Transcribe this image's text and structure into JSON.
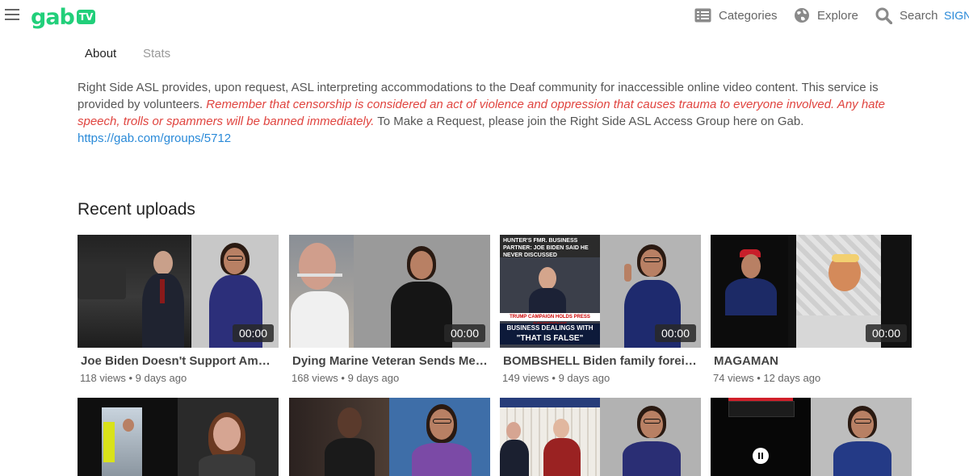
{
  "header": {
    "logo_text": "gab",
    "logo_badge": "TV",
    "nav": [
      {
        "label": "Categories",
        "icon": "categories-icon"
      },
      {
        "label": "Explore",
        "icon": "globe-icon"
      },
      {
        "label": "Search",
        "icon": "search-icon"
      }
    ],
    "signup_label": "SIGN"
  },
  "tabs": [
    {
      "label": "About",
      "active": true
    },
    {
      "label": "Stats",
      "active": false
    }
  ],
  "about": {
    "intro": "Right Side ASL provides, upon request, ASL interpreting accommodations to the Deaf community for inaccessible online video content. This service is provided by volunteers.",
    "warning": "Remember that censorship is considered an act of violence and oppression that causes trauma to everyone involved. Any hate speech, trolls or spammers will be banned immediately.",
    "request": "To Make a Request, please join the Right Side ASL Access Group here on Gab.",
    "link": "https://gab.com/groups/5712"
  },
  "recent_uploads": {
    "title": "Recent uploads",
    "videos": [
      {
        "title": "Joe Biden Doesn't Support Ameri...",
        "duration": "00:00",
        "views": "118 views",
        "age": "9 days ago"
      },
      {
        "title": "Dying Marine Veteran Sends Mess...",
        "duration": "00:00",
        "views": "168 views",
        "age": "9 days ago"
      },
      {
        "title": "BOMBSHELL Biden family foreign ...",
        "duration": "00:00",
        "views": "149 views",
        "age": "9 days ago",
        "thumb_text": {
          "top": "HUNTER'S FMR. BUSINESS PARTNER: JOE BIDEN SAID HE NEVER DISCUSSED",
          "mid": "TRUMP CAMPAIGN HOLDS PRESS CONFERENCE",
          "bottom": "BUSINESS DEALINGS WITH SON",
          "quote": "\"THAT IS FALSE\""
        }
      },
      {
        "title": "MAGAMAN",
        "duration": "00:00",
        "views": "74 views",
        "age": "12 days ago"
      }
    ]
  },
  "colors": {
    "brand": "#21cf7a",
    "link": "#2a8ad8",
    "warning": "#e0443f"
  }
}
